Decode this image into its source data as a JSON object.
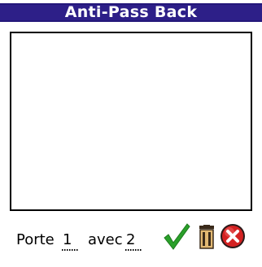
{
  "window": {
    "title": "Anti-Pass Back"
  },
  "list": {
    "items": []
  },
  "form": {
    "porte_label": "Porte",
    "porte_value": "1",
    "avec_label": "avec",
    "avec_value": "2"
  },
  "icons": {
    "ok": "checkmark-icon",
    "delete": "trash-icon",
    "cancel": "close-circle-icon"
  },
  "colors": {
    "title_bar": "#2d1f88",
    "ok": "#2aa02a",
    "cancel": "#d42222"
  }
}
